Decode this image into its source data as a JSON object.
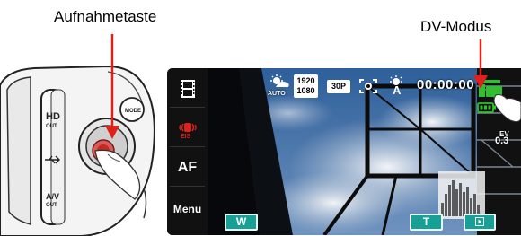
{
  "callouts": {
    "record_button": "Aufnahmetaste",
    "dv_mode": "DV-Modus"
  },
  "camera": {
    "port_hd": "HD\nOUT",
    "port_usb": "⭠",
    "port_av": "A/V\nOUT",
    "mode_label": "MODE"
  },
  "screen": {
    "sidebar": {
      "menu_label": "Menu",
      "af_label": "AF",
      "stabilizer_icon": "eis-icon",
      "scene_icon": "film-icon"
    },
    "hud": {
      "resolution_top": "1920",
      "resolution_bottom": "1080",
      "frame_rate": "30P",
      "auto_label": "AUTO",
      "timecode": "00:00:00",
      "ev_label": "EV",
      "ev_value": "0.3"
    },
    "buttons": {
      "zoom_wide": "W",
      "zoom_tele": "T",
      "play_icon": "play-icon"
    },
    "colors": {
      "accent_button": "#17a096",
      "mode_icon": "#2fbf2f",
      "red_dot": "#e0201a",
      "sky": "#3b6fa8"
    }
  }
}
